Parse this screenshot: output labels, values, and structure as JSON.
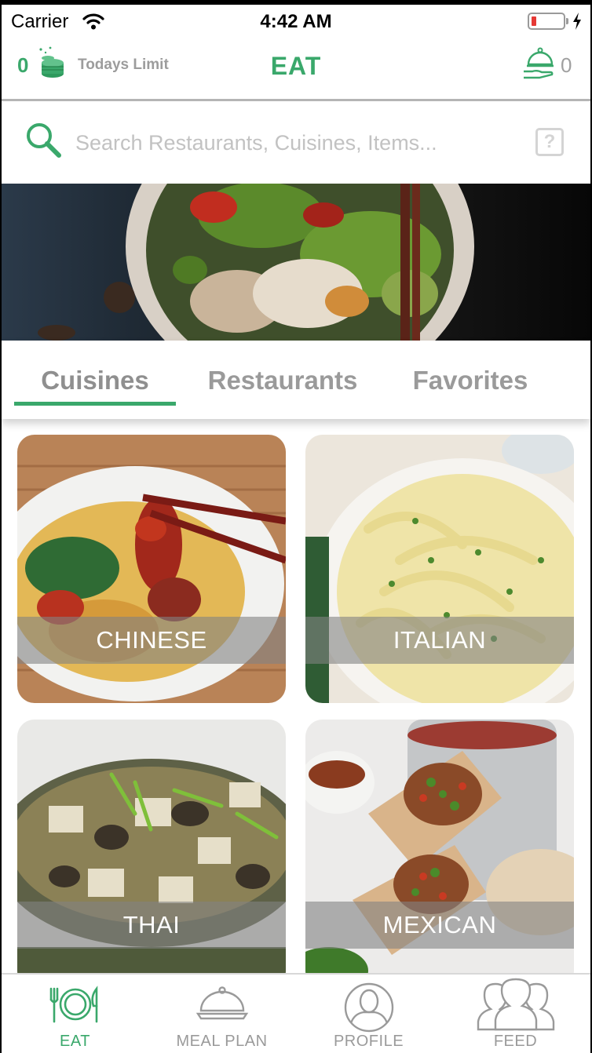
{
  "status_bar": {
    "carrier": "Carrier",
    "time": "4:42 AM"
  },
  "header": {
    "limit_count": "0",
    "limit_label": "Todays Limit",
    "title": "EAT",
    "cart_count": "0"
  },
  "search": {
    "placeholder": "Search Restaurants, Cuisines, Items...",
    "help_label": "?"
  },
  "tabs": [
    {
      "label": "Cuisines",
      "active": true
    },
    {
      "label": "Restaurants",
      "active": false
    },
    {
      "label": "Favorites",
      "active": false
    }
  ],
  "cuisines": [
    {
      "label": "CHINESE"
    },
    {
      "label": "ITALIAN"
    },
    {
      "label": "THAI"
    },
    {
      "label": "MEXICAN"
    }
  ],
  "tab_bar": [
    {
      "label": "EAT",
      "icon": "plate-fork-knife-icon",
      "active": true
    },
    {
      "label": "MEAL PLAN",
      "icon": "cloche-icon",
      "active": false
    },
    {
      "label": "PROFILE",
      "icon": "person-icon",
      "active": false
    },
    {
      "label": "FEED",
      "icon": "group-icon",
      "active": false
    }
  ],
  "colors": {
    "accent": "#3aa86b",
    "inactive": "#9a9a9a"
  }
}
